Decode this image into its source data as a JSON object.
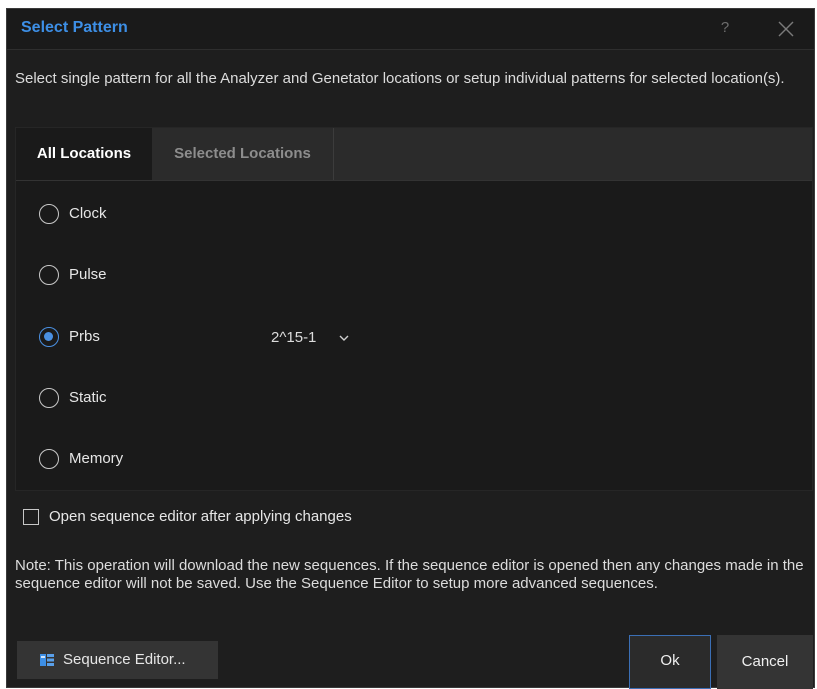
{
  "dialog": {
    "title": "Select Pattern",
    "help_icon": "question-mark-icon",
    "close_icon": "close-icon",
    "title_color": "#3d8fe6"
  },
  "intro_text": "Select single pattern for all the Analyzer and Genetator locations or setup individual patterns for selected location(s).",
  "tabs": [
    {
      "label": "All Locations",
      "active": true
    },
    {
      "label": "Selected Locations",
      "active": false
    }
  ],
  "patterns": [
    {
      "label": "Clock",
      "checked": false
    },
    {
      "label": "Pulse",
      "checked": false
    },
    {
      "label": "Prbs",
      "checked": true
    },
    {
      "label": "Static",
      "checked": false
    },
    {
      "label": "Memory",
      "checked": false
    }
  ],
  "prbs_select": {
    "value": "2^15-1",
    "icon": "chevron-down-icon"
  },
  "open_editor_checkbox": {
    "label": "Open sequence editor after applying changes",
    "checked": false
  },
  "note": "Note: This operation will download the new sequences. If the sequence editor is opened then any changes made in the sequence editor will not be saved. Use the Sequence Editor to setup more advanced sequences.",
  "buttons": {
    "sequence_editor": "Sequence Editor...",
    "sequence_editor_icon": "sequence-editor-icon",
    "ok": "Ok",
    "cancel": "Cancel"
  },
  "colors": {
    "accent": "#4a90e2",
    "background": "#1e1e1e",
    "ok_border": "#3b6fb5"
  }
}
